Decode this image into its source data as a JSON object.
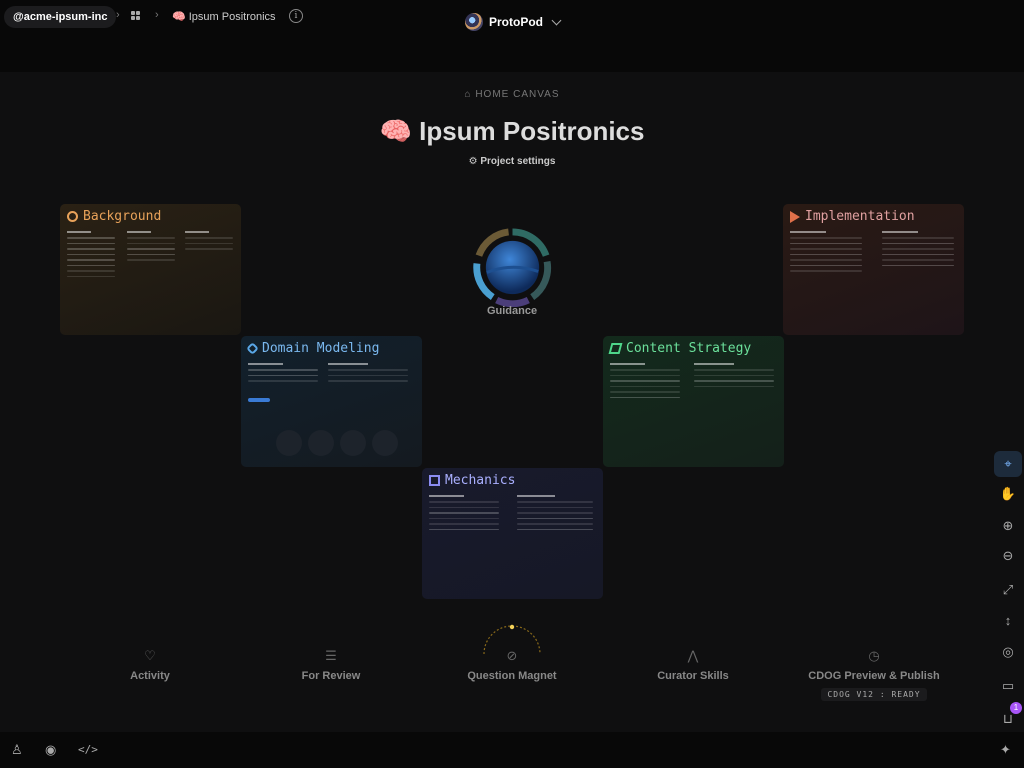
{
  "topbar": {
    "org": "@acme-ipsum-inc",
    "project": "🧠 Ipsum Positronics",
    "app_name": "ProtoPod"
  },
  "header": {
    "section": "HOME CANVAS",
    "title": "🧠 Ipsum Positronics",
    "settings": "Project settings"
  },
  "cards": {
    "background": {
      "title": "Background",
      "color": "#e8a25a"
    },
    "implementation": {
      "title": "Implementation",
      "color": "#e0704a"
    },
    "domain_modeling": {
      "title": "Domain Modeling",
      "color": "#5aa8e8"
    },
    "content_strategy": {
      "title": "Content Strategy",
      "color": "#4ed68a"
    },
    "mechanics": {
      "title": "Mechanics",
      "color": "#8b8cf2"
    }
  },
  "guidance": {
    "label": "Guidance"
  },
  "bottom_nav": {
    "activity": "Activity",
    "for_review": "For Review",
    "question_magnet": "Question Magnet",
    "curator_skills": "Curator Skills",
    "cdog": "CDOG Preview & Publish",
    "cdog_status": "CDOG V12 : READY"
  },
  "tools": {
    "inbox_badge": "1"
  },
  "colors": {
    "accent": "#7db8ff",
    "badge": "#a855f7"
  }
}
